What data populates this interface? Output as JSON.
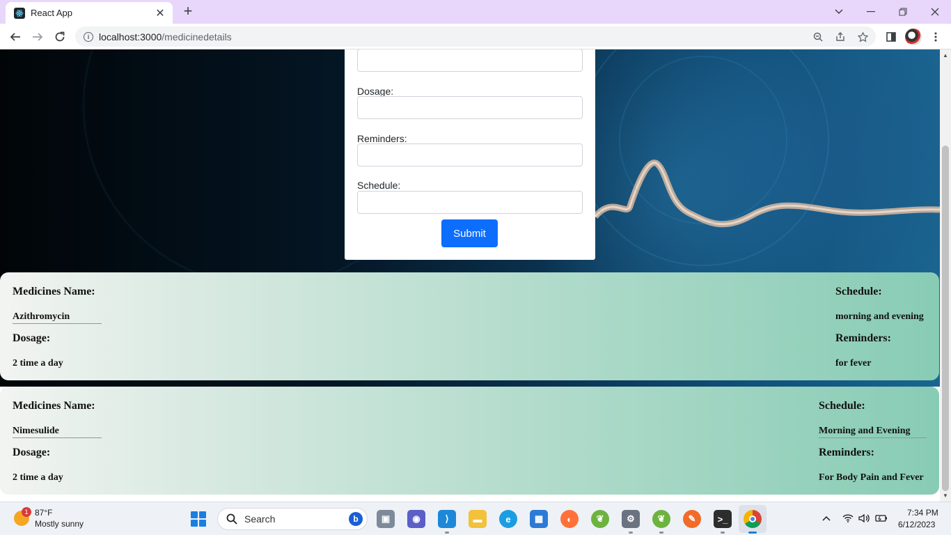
{
  "browser": {
    "tab_title": "React App",
    "url_host": "localhost:3000",
    "url_path": "/medicinedetails"
  },
  "form": {
    "dosage_label": "Dosage:",
    "reminders_label": "Reminders:",
    "schedule_label": "Schedule:",
    "submit_label": "Submit"
  },
  "medicines": [
    {
      "name_heading": "Medicines Name:",
      "name": "Azithromycin",
      "dosage_heading": "Dosage:",
      "dosage": "2 time a day",
      "schedule_heading": "Schedule:",
      "schedule": "morning and evening",
      "reminders_heading": "Reminders:",
      "reminders": "for fever"
    },
    {
      "name_heading": "Medicines Name:",
      "name": "Nimesulide",
      "dosage_heading": "Dosage:",
      "dosage": "2 time a day",
      "schedule_heading": "Schedule:",
      "schedule": "Morning and Evening",
      "reminders_heading": "Reminders:",
      "reminders": "For Body Pain and Fever"
    }
  ],
  "taskbar": {
    "weather_badge": "1",
    "weather_temp": "87°F",
    "weather_desc": "Mostly sunny",
    "search_label": "Search",
    "time": "7:34 PM",
    "date": "6/12/2023"
  },
  "colors": {
    "submit_button": "#0d6efd",
    "tabbar": "#e8d7fb",
    "card_gradient_end": "#88ccb5"
  }
}
